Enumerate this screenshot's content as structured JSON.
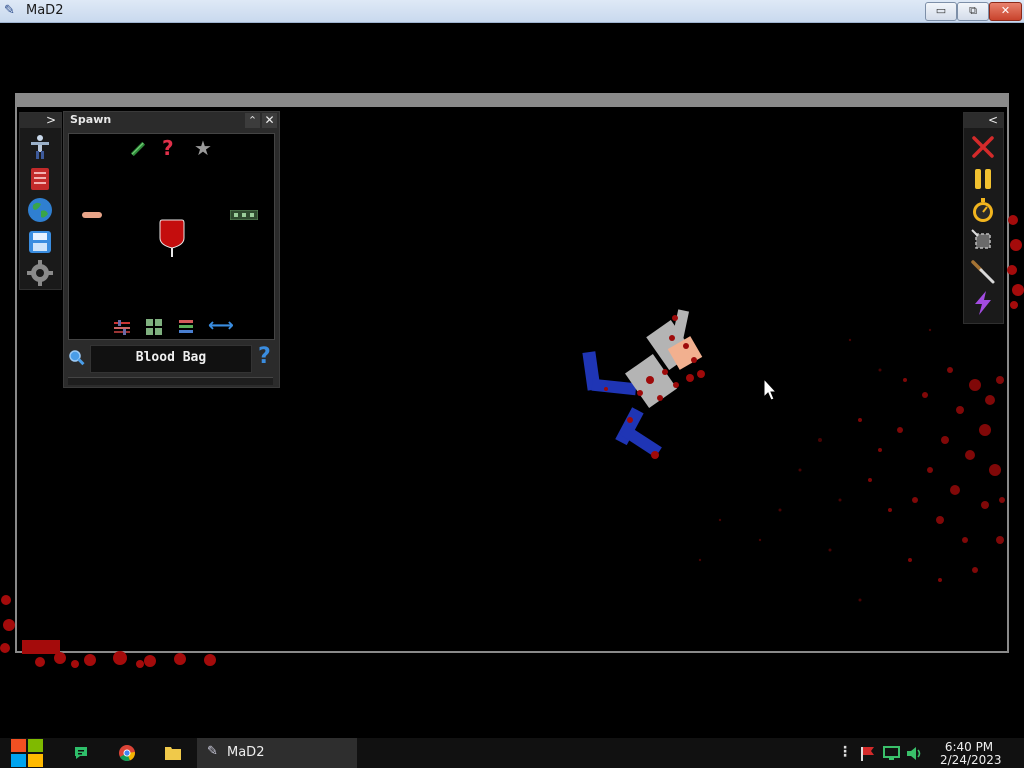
{
  "window": {
    "title": "MaD2",
    "minimize_glyph": "▭",
    "maximize_glyph": "⧉",
    "close_glyph": "✕"
  },
  "left_toolbar": {
    "expand_glyph": ">",
    "tools": [
      {
        "name": "human-icon"
      },
      {
        "name": "catalog-book-icon"
      },
      {
        "name": "globe-icon"
      },
      {
        "name": "save-disk-icon"
      },
      {
        "name": "settings-gear-icon"
      }
    ]
  },
  "spawn_panel": {
    "title": "Spawn",
    "collapse_glyph": "⌃",
    "close_glyph": "✕",
    "search_value": "Blood Bag",
    "help_glyph": "?",
    "items": [
      {
        "name": "syringe-icon"
      },
      {
        "name": "random-question-icon",
        "glyph": "?"
      },
      {
        "name": "favorite-star-icon",
        "glyph": "★"
      },
      {
        "name": "bandage-icon"
      },
      {
        "name": "blood-bag-icon"
      },
      {
        "name": "circuit-board-icon"
      }
    ],
    "filters": [
      {
        "name": "sliders-filter-icon"
      },
      {
        "name": "grid-view-icon"
      },
      {
        "name": "list-view-icon"
      },
      {
        "name": "swap-arrows-icon",
        "glyph": "⟷"
      }
    ]
  },
  "right_toolbar": {
    "collapse_glyph": "<",
    "tools": [
      {
        "name": "clear-x-icon"
      },
      {
        "name": "pause-icon"
      },
      {
        "name": "stopwatch-icon"
      },
      {
        "name": "select-area-icon"
      },
      {
        "name": "knife-tool-icon"
      },
      {
        "name": "lightning-icon"
      }
    ]
  },
  "taskbar": {
    "start_icon": "windows-start-icon",
    "pinned": [
      "app-green-icon",
      "chrome-icon",
      "folder-icon"
    ],
    "active_app_label": "MaD2",
    "tray": [
      "more-icon",
      "flag-icon",
      "network-icon",
      "volume-icon"
    ],
    "time": "6:40 PM",
    "date": "2/24/2023"
  },
  "colors": {
    "blood": "#9e0a0a",
    "ragdoll_limb_blue": "#1f35b5",
    "ragdoll_body_gray": "#b4b4b4",
    "ragdoll_head": "#f2b08f",
    "arena_border": "#8a8a8a",
    "accent_blue": "#3a8de0"
  }
}
